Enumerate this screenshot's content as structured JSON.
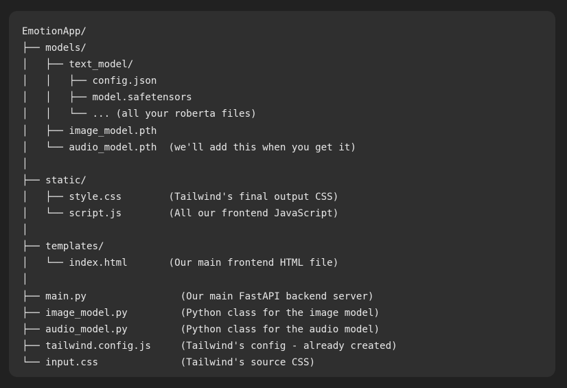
{
  "code_block": {
    "lines": [
      "EmotionApp/",
      "├── models/",
      "│   ├── text_model/",
      "│   │   ├── config.json",
      "│   │   ├── model.safetensors",
      "│   │   └── ... (all your roberta files)",
      "│   ├── image_model.pth",
      "│   └── audio_model.pth  (we'll add this when you get it)",
      "│",
      "├── static/",
      "│   ├── style.css        (Tailwind's final output CSS)",
      "│   └── script.js        (All our frontend JavaScript)",
      "│",
      "├── templates/",
      "│   └── index.html       (Our main frontend HTML file)",
      "│",
      "├── main.py                (Our main FastAPI backend server)",
      "├── image_model.py         (Python class for the image model)",
      "├── audio_model.py         (Python class for the audio model)",
      "├── tailwind.config.js     (Tailwind's config - already created)",
      "└── input.css              (Tailwind's source CSS)"
    ]
  }
}
